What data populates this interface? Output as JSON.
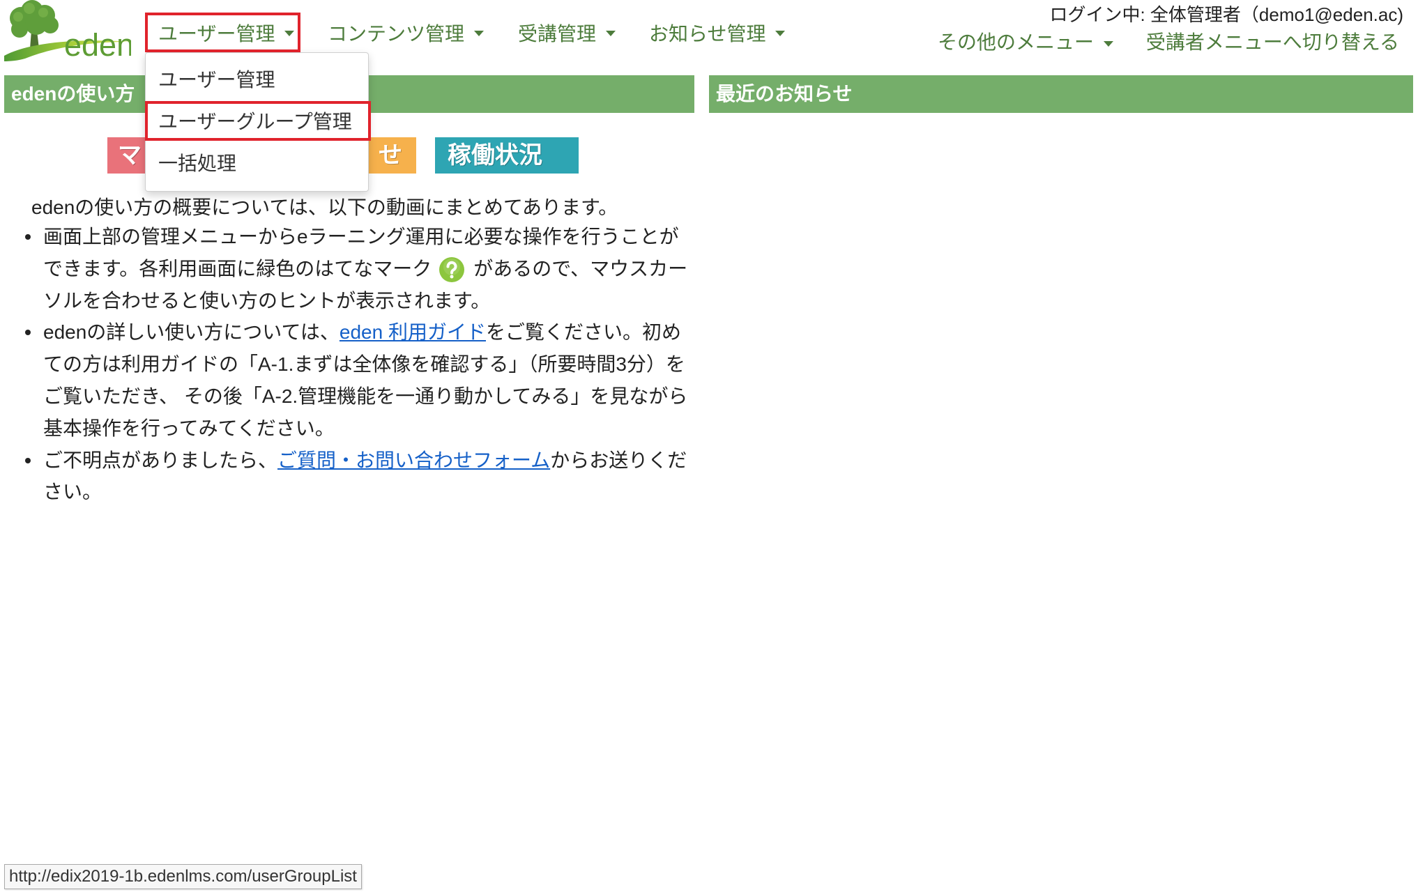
{
  "logo": {
    "text": "eden"
  },
  "nav": {
    "items": [
      {
        "label": "ユーザー管理"
      },
      {
        "label": "コンテンツ管理"
      },
      {
        "label": "受講管理"
      },
      {
        "label": "お知らせ管理"
      }
    ],
    "dropdown": [
      {
        "label": "ユーザー管理"
      },
      {
        "label": "ユーザーグループ管理"
      },
      {
        "label": "一括処理"
      }
    ]
  },
  "account": {
    "login_status": "ログイン中: 全体管理者（demo1@eden.ac)",
    "other_menu": "その他のメニュー",
    "switch_to_learner": "受講者メニューへ切り替える"
  },
  "guide": {
    "title": "edenの使い方",
    "buttons": [
      {
        "label": "マ",
        "color": "#e9727a"
      },
      {
        "label": "せ",
        "color": "#f6b14c"
      },
      {
        "label": "稼働状況",
        "color": "#2ea5b3"
      }
    ],
    "intro": "edenの使い方の概要については、以下の動画にまとめてあります。",
    "tips": [
      {
        "line1": "画面上部の管理メニューからeラーニング運用に必要な操作を行うことが",
        "line2_before_icon": "できます。各利用画面に緑色のはてなマーク",
        "line2_after_icon": "があるので、マウスカー",
        "line3": "ソルを合わせると使い方のヒントが表示されます。"
      },
      {
        "line1_before_link": "edenの詳しい使い方については、",
        "link": "eden 利用ガイド",
        "line1_after_link": "をご覧ください。初め",
        "line2": "ての方は利用ガイドの「A-1.まずは全体像を確認する」（所要時間3分）を",
        "line3": "ご覧いただき、 その後「A-2.管理機能を一通り動かしてみる」を見ながら",
        "line4": "基本操作を行ってみてください。"
      },
      {
        "line1_before_link": "ご不明点がありましたら、",
        "link": "ご質問・お問い合わせフォーム",
        "line1_after_link": "からお送りくだ",
        "line2": "さい。"
      }
    ]
  },
  "news": {
    "title": "最近のお知らせ"
  },
  "status_bar": {
    "url": "http://edix2019-1b.edenlms.com/userGroupList"
  },
  "icons": {
    "logo": "tree-icon",
    "menu_caret": "caret-down-icon",
    "help": "help-icon"
  },
  "theme": {
    "header_green": "#75ae6a",
    "nav_text": "#4d7c3c",
    "highlight_red": "#e0232c",
    "link_blue": "#1560c8",
    "help_icon_green": "#8cc63e"
  }
}
